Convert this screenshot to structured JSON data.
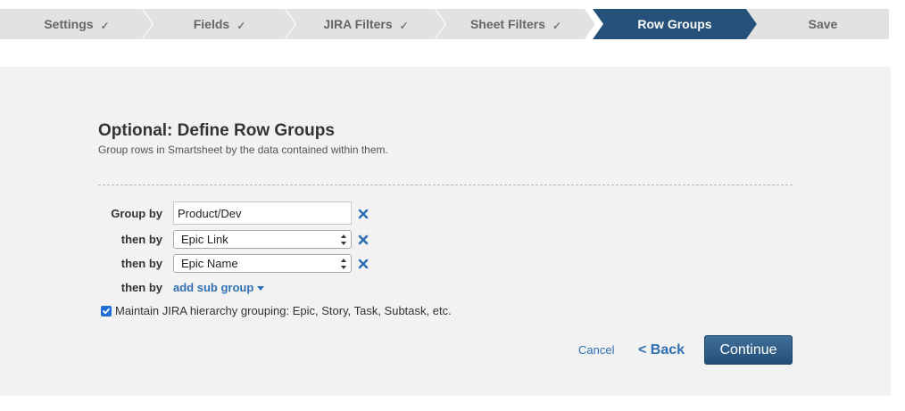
{
  "wizard": {
    "steps": [
      {
        "label": "Settings",
        "check": "✓"
      },
      {
        "label": "Fields",
        "check": "✓"
      },
      {
        "label": "JIRA Filters",
        "check": "✓"
      },
      {
        "label": "Sheet Filters",
        "check": "✓"
      },
      {
        "label": "Row Groups",
        "check": ""
      },
      {
        "label": "Save",
        "check": ""
      }
    ],
    "active_step": "Row Groups",
    "active_color": "#26517a",
    "inactive_color": "#e2e2e2"
  },
  "form": {
    "title": "Optional: Define Row Groups",
    "subtitle": "Group rows in Smartsheet by the data contained within them.",
    "group_by_label": "Group by",
    "group_by_value": "Product/Dev",
    "then_by_label": "then by",
    "then_by_1": "Epic Link",
    "then_by_2": "Epic Name",
    "add_sub_group": "add sub group",
    "maintain_hierarchy_label": "Maintain JIRA hierarchy grouping: Epic, Story, Task, Subtask, etc.",
    "maintain_hierarchy_checked": true
  },
  "actions": {
    "cancel": "Cancel",
    "back": "< Back",
    "continue": "Continue"
  },
  "colors": {
    "link": "#2f6fb5",
    "continue_button": "#2e5c86",
    "panel_bg": "#f2f2f2"
  }
}
